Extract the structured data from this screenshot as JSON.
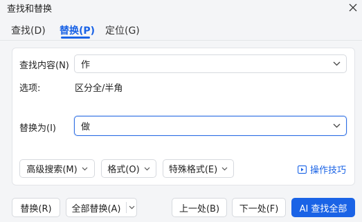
{
  "window": {
    "title": "查找和替换",
    "icons": {
      "close": "close-icon"
    }
  },
  "tabs": [
    {
      "label": "查找(D)",
      "active": false
    },
    {
      "label": "替换(P)",
      "active": true
    },
    {
      "label": "定位(G)",
      "active": false
    }
  ],
  "form": {
    "find_label": "查找内容(N)",
    "find_value": "作",
    "options_label": "选项:",
    "options_value": "区分全/半角",
    "replace_label": "替换为(I)",
    "replace_value": "做"
  },
  "panel_buttons": {
    "advanced": "高级搜索(M)",
    "format": "格式(O)",
    "special": "特殊格式(E)",
    "tips": "操作技巧",
    "tips_icon": "play-video-icon"
  },
  "footer": {
    "replace": "替换(R)",
    "replace_all": "全部替换(A)",
    "prev": "上一处(B)",
    "next": "下一处(F)",
    "find_all": "AI 查找全部"
  },
  "colors": {
    "accent": "#1a63e6",
    "background": "#f4f5f7",
    "panel": "#ffffff",
    "border": "#d6d9de"
  }
}
